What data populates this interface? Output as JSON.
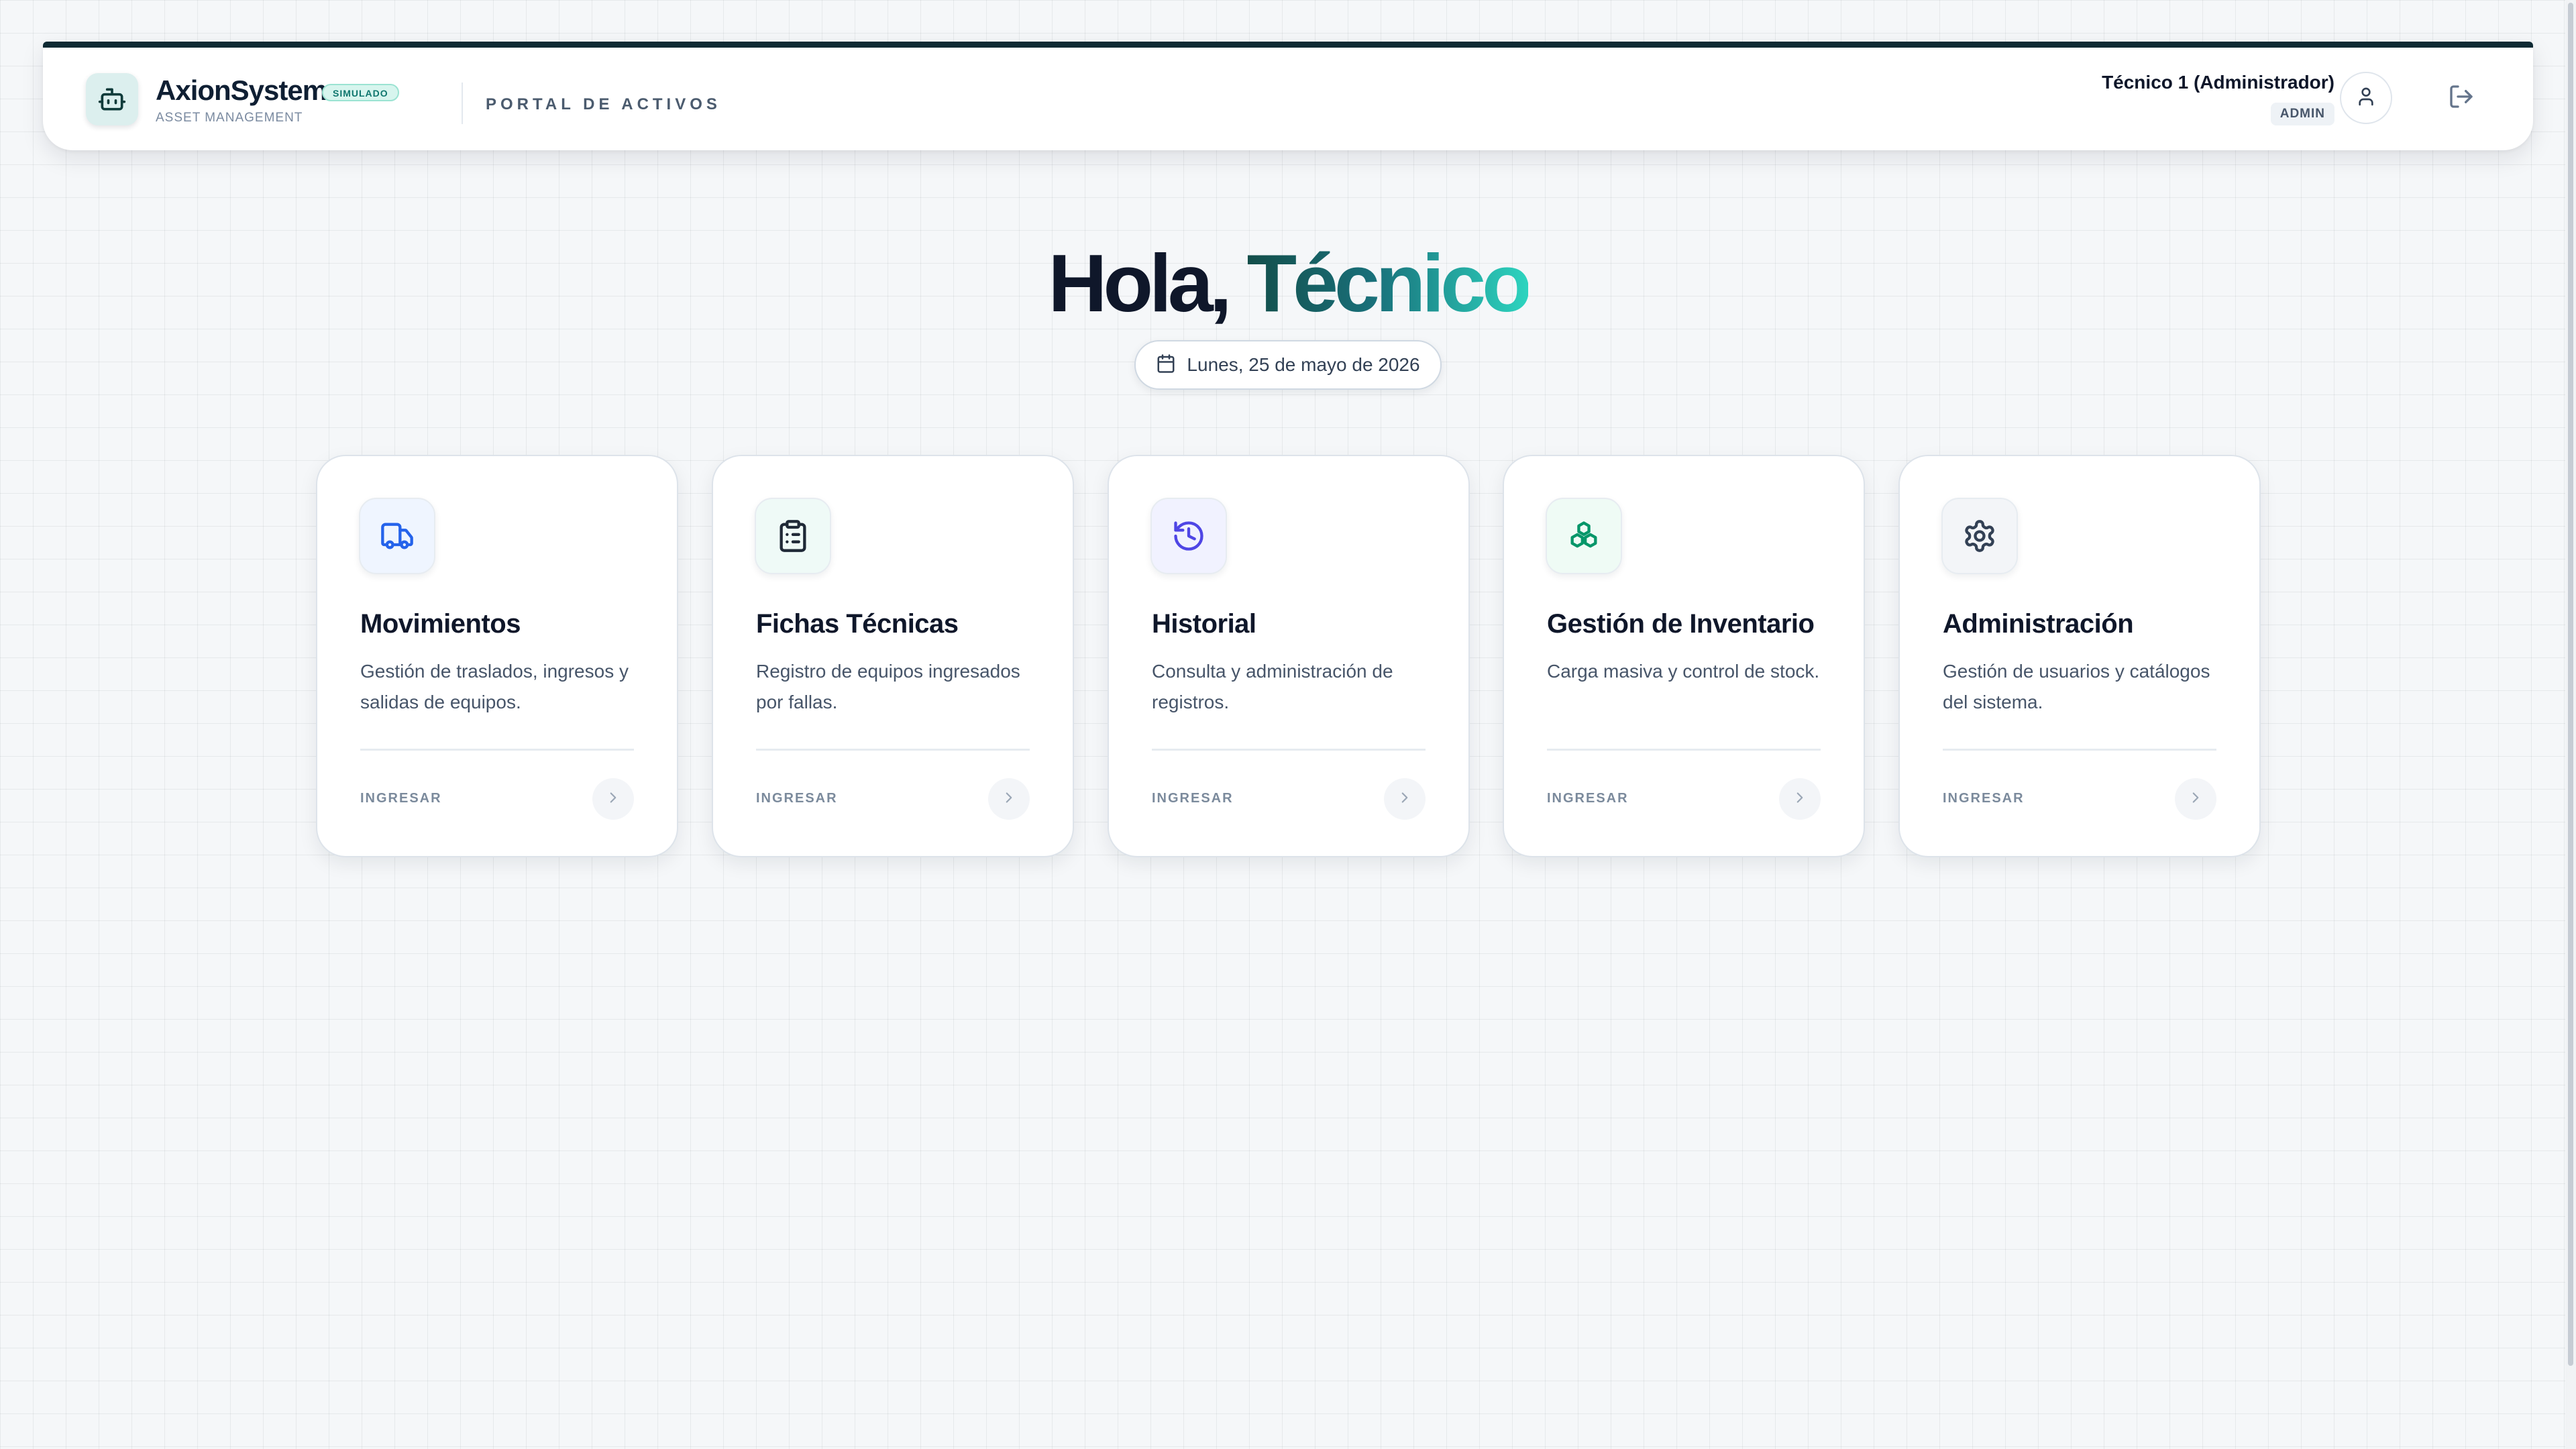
{
  "header": {
    "brand_name": "AxionSystem",
    "brand_badge": "SIMULADO",
    "brand_subtitle": "ASSET MANAGEMENT",
    "portal_label": "PORTAL DE ACTIVOS",
    "user_name": "Técnico 1 (Administrador)",
    "user_role": "ADMIN",
    "icons": {
      "brand": "robot-icon",
      "avatar": "user-icon",
      "logout": "logout-icon"
    }
  },
  "greeting": {
    "prefix": "Hola, ",
    "name": "Técnico",
    "date": "Lunes, 25 de mayo de 2026",
    "date_icon": "calendar-icon"
  },
  "cards": [
    {
      "title": "Movimientos",
      "description": "Gestión de traslados, ingresos y salidas de equipos.",
      "cta": "INGRESAR",
      "icon": "truck-icon",
      "icon_color": "#2563eb",
      "icon_bg": "#eff5ff"
    },
    {
      "title": "Fichas Técnicas",
      "description": "Registro de equipos ingresados por fallas.",
      "cta": "INGRESAR",
      "icon": "clipboard-list-icon",
      "icon_color": "#1f2937",
      "icon_bg": "#effaf7"
    },
    {
      "title": "Historial",
      "description": "Consulta y administración de registros.",
      "cta": "INGRESAR",
      "icon": "history-icon",
      "icon_color": "#4f46e5",
      "icon_bg": "#f1f2ff"
    },
    {
      "title": "Gestión de Inventario",
      "description": "Carga masiva y control de stock.",
      "cta": "INGRESAR",
      "icon": "boxes-icon",
      "icon_color": "#059669",
      "icon_bg": "#effbf5"
    },
    {
      "title": "Administración",
      "description": "Gestión de usuarios y catálogos del sistema.",
      "cta": "INGRESAR",
      "icon": "gear-icon",
      "icon_color": "#334155",
      "icon_bg": "#f3f5f8"
    }
  ],
  "colors": {
    "header_accent": "#0e2a33",
    "greeting_gradient_start": "#134e4a",
    "greeting_gradient_end": "#2dd4bf"
  }
}
